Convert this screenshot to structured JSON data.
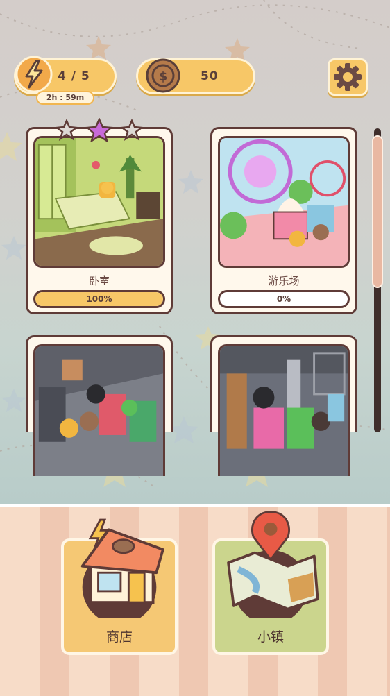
{
  "hud": {
    "energy_icon": "lightning-icon",
    "energy_value": "4 / 5",
    "energy_timer": "2h : 59m",
    "coin_icon": "coin-icon",
    "coins": "50",
    "settings_icon": "gear-icon"
  },
  "levels": [
    {
      "name": "卧室",
      "progress_label": "100%",
      "progress": 1.0,
      "stars_earned": 1,
      "stars_total": 3
    },
    {
      "name": "游乐场",
      "progress_label": "0%",
      "progress": 0.0
    },
    {
      "name": ""
    },
    {
      "name": ""
    }
  ],
  "nav": {
    "shop_label": "商店",
    "shop_icon": "shop-house-icon",
    "town_label": "小镇",
    "town_icon": "map-pin-icon"
  },
  "colors": {
    "accent_yellow": "#f7c767",
    "outline_brown": "#5f3b37",
    "star_purple": "#c86ad8"
  }
}
